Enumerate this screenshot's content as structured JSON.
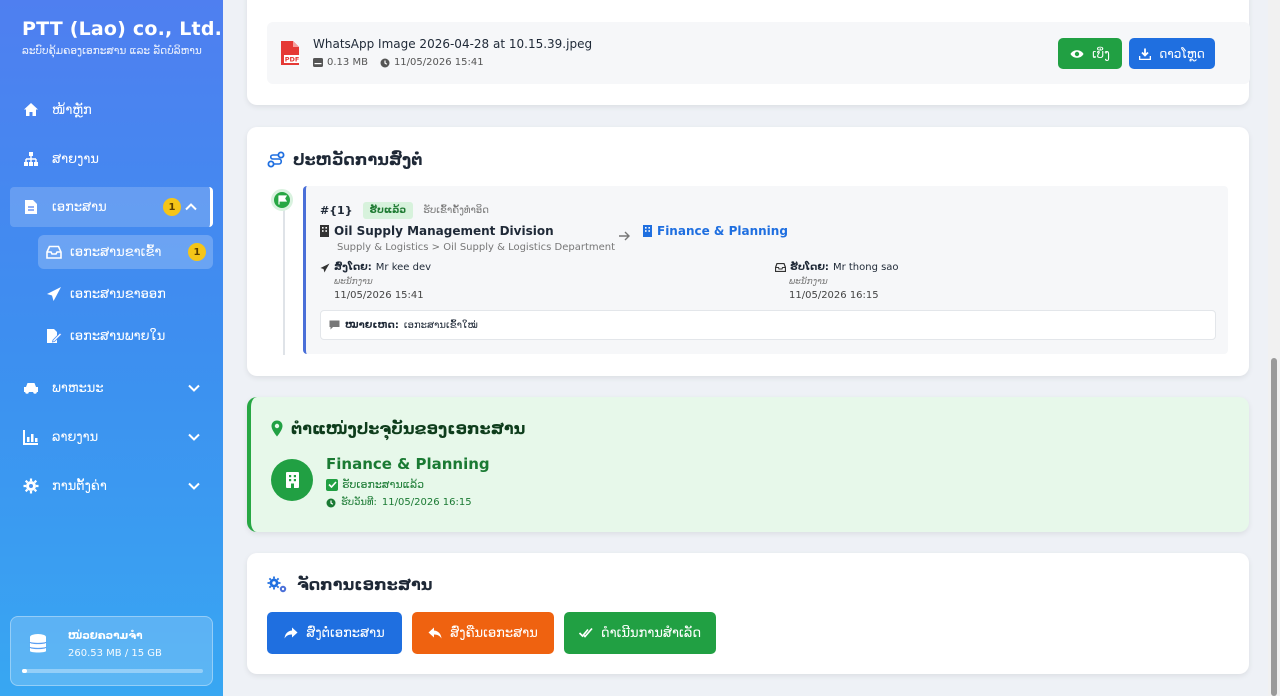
{
  "brand": {
    "name": "PTT (Lao) co., Ltd.",
    "subtitle": "ລະບົບຄຸ້ມຄອງເອກະສານ ແລະ ລັດບໍລິຫານ"
  },
  "sidebar": {
    "items": [
      {
        "label": "ໜ້າຫຼັກ",
        "icon": "home-icon"
      },
      {
        "label": "ສາຍງານ",
        "icon": "org-chart-icon"
      },
      {
        "label": "ເອກະສານ",
        "icon": "document-icon",
        "badge": "1"
      },
      {
        "label": "ພາຫະນະ",
        "icon": "car-icon"
      },
      {
        "label": "ລາຍງານ",
        "icon": "chart-icon"
      },
      {
        "label": "ການຕັ້ງຄ່າ",
        "icon": "gear-icon"
      }
    ],
    "subitems": [
      {
        "label": "ເອກະສານຂາເຂົ້າ",
        "icon": "inbox-icon",
        "badge": "1"
      },
      {
        "label": "ເອກະສານຂາອອກ",
        "icon": "paper-plane-icon"
      },
      {
        "label": "ເອກະສານພາຍໃນ",
        "icon": "file-signature-icon"
      }
    ],
    "storage": {
      "title": "ໜ່ວຍຄວາມຈຳ",
      "usage": "260.53 MB / 15 GB",
      "fraction": 0.017
    }
  },
  "attachment": {
    "name": "WhatsApp Image 2026-04-28 at 10.15.39.jpeg",
    "size": "0.13 MB",
    "date": "11/05/2026 15:41",
    "view_label": "ເບິ່ງ",
    "download_label": "ດາວໂຫຼດ"
  },
  "history": {
    "title": "ປະຫວັດການສົ່ງຕໍ່",
    "entry": {
      "number": "#{1}",
      "status": "ຮັບແລ້ວ",
      "status_desc": "ຮັບເຂົ້າຄັ້ງທຳອິດ",
      "from_org": "Oil Supply Management Division",
      "from_path": "Supply & Logistics > Oil Supply & Logistics Department",
      "to_org": "Finance & Planning",
      "sent_by_label": "ສົ່ງໂດຍ:",
      "sent_by": "Mr kee dev",
      "sender_role": "ພະນັກງານ",
      "sent_time": "11/05/2026 15:41",
      "recv_by_label": "ຮັບໂດຍ:",
      "recv_by": "Mr thong sao",
      "receiver_role": "ພະນັກງານ",
      "recv_time": "11/05/2026 16:15",
      "note_label": "ໝາຍເຫດ:",
      "note": "ເອກະສານເຂົ້າໃໝ່"
    }
  },
  "location": {
    "title": "ຕຳແໜ່ງປະຈຸບັນຂອງເອກະສານ",
    "org": "Finance & Planning",
    "status": "ຮັບເອກະສານແລ້ວ",
    "date_label": "ຮັບວັນທີ:",
    "date": "11/05/2026 16:15"
  },
  "manage": {
    "title": "ຈັດການເອກະສານ",
    "forward_label": "ສົ່ງຕໍ່ເອກະສານ",
    "return_label": "ສົ່ງຄືນເອກະສານ",
    "complete_label": "ດຳເນີນການສຳເລັດ"
  },
  "colors": {
    "primary": "#1f6fe0",
    "success": "#21a043",
    "danger": "#ef6210",
    "sidebar": "#4f7ff0"
  }
}
